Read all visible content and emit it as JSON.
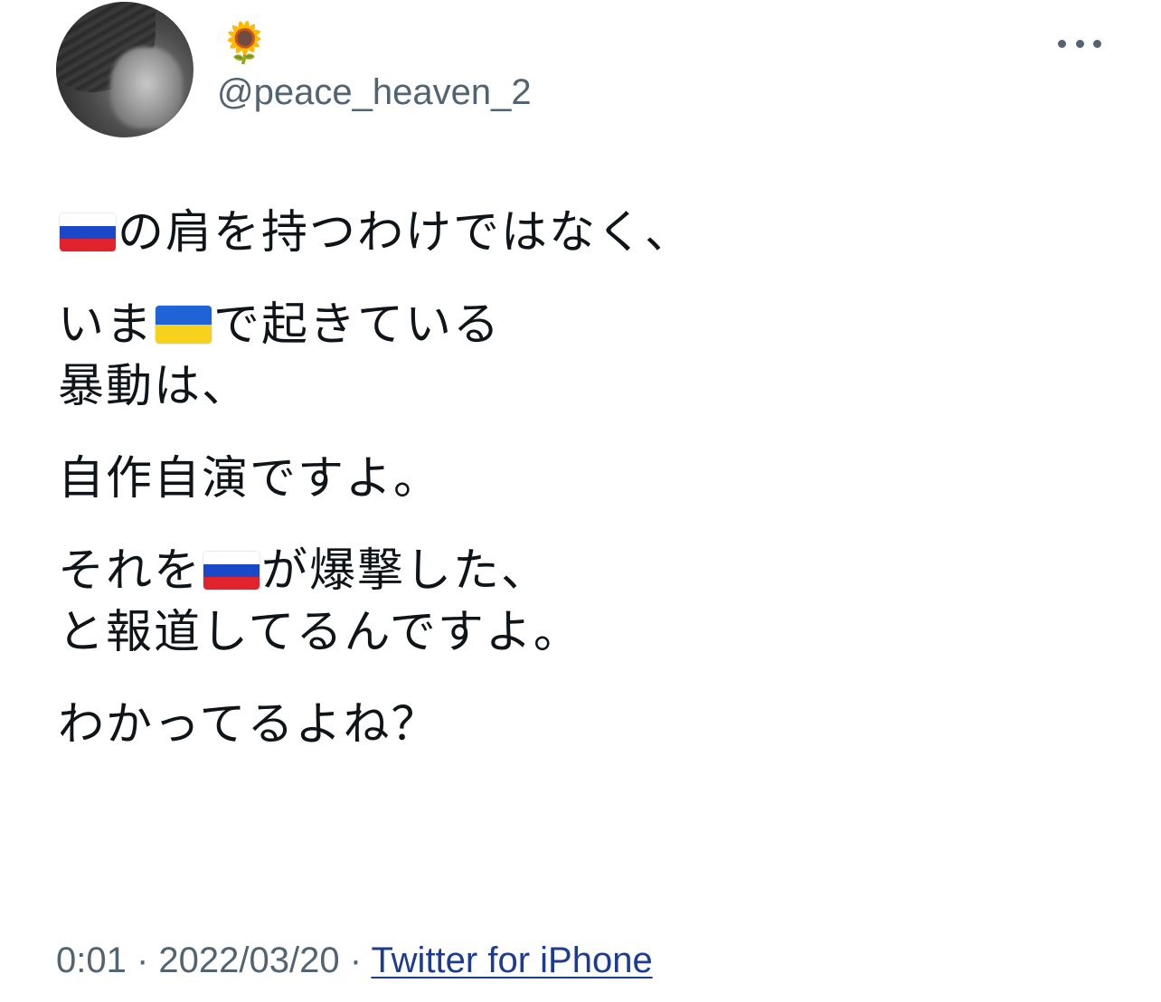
{
  "author": {
    "display_name": "🌻",
    "username": "@peace_heaven_2",
    "avatar_icon": "profile-photo"
  },
  "more_icon": "more-horizontal-icon",
  "tweet": {
    "segments": {
      "p1_l1_after": "の肩を持つわけではなく、",
      "p2_l1_before": "いま",
      "p2_l1_after": "で起きている",
      "p2_l2": "暴動は、",
      "p3_l1": "自作自演ですよ。",
      "p4_l1_before": "それを",
      "p4_l1_after": "が爆撃した、",
      "p4_l2": "と報道してるんですよ。",
      "p5_l1": "わかってるよね？"
    },
    "flags": {
      "russia": "flag-russia-icon",
      "ukraine": "flag-ukraine-icon"
    }
  },
  "meta": {
    "time": "0:01",
    "separator": " · ",
    "date": "2022/03/20",
    "source": "Twitter for iPhone"
  },
  "colors": {
    "text": "#0f1419",
    "secondary": "#536471",
    "link": "#1d3b8f"
  }
}
